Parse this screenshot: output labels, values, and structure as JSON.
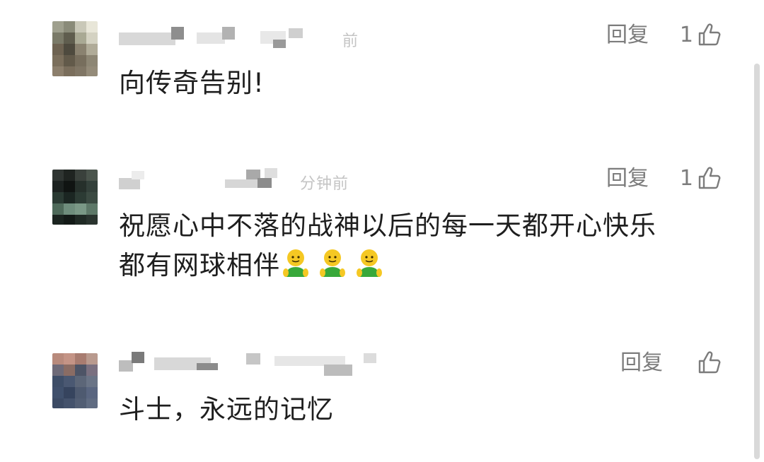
{
  "comments": [
    {
      "reply_label": "回复",
      "like_count": "1",
      "text": "向传奇告别!",
      "visible_meta": "前"
    },
    {
      "reply_label": "回复",
      "like_count": "1",
      "text_line1": "祝愿心中不落的战神以后的每一天都开心快乐",
      "text_line2": "都有网球相伴",
      "visible_meta": "分钟前"
    },
    {
      "reply_label": "回复",
      "like_count": "",
      "text": "斗士，永远的记忆"
    }
  ],
  "icons": {
    "thumb": "thumbs-up-icon",
    "emoji": "green-figure-emoji"
  },
  "colors": {
    "reply_text": "#7c7c7c",
    "comment_text": "#1e1e1e",
    "meta_text": "#c4c4c4"
  }
}
